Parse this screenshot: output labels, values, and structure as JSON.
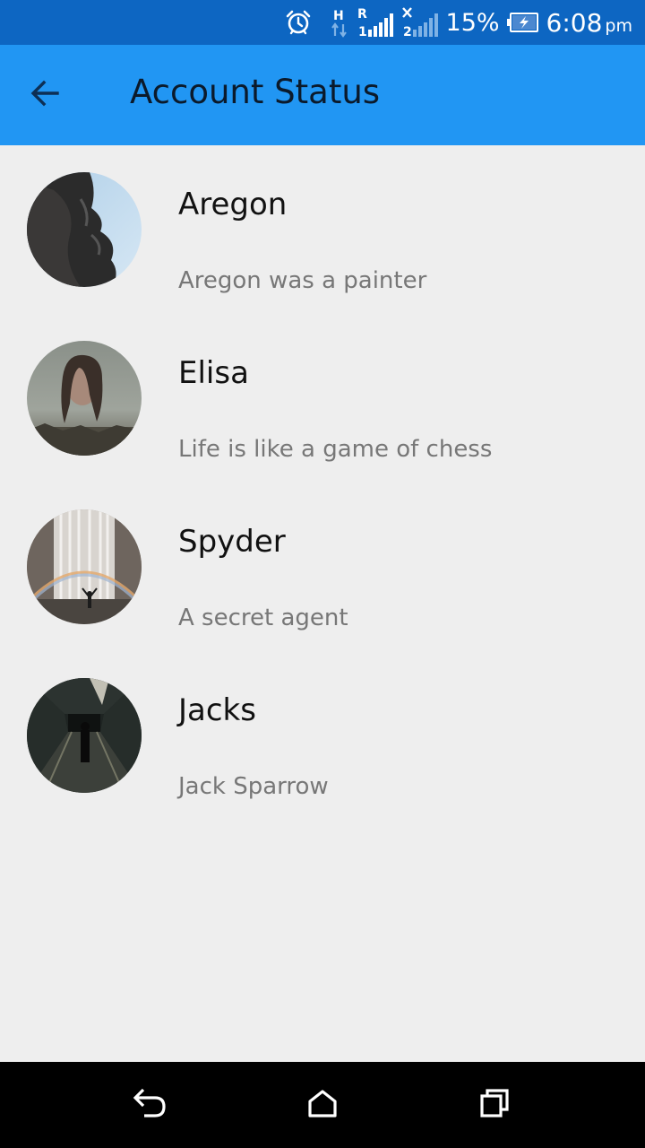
{
  "status_bar": {
    "icons": [
      "alarm-icon",
      "h-data-icon",
      "sim1-signal-icon",
      "sim2-signal-icon",
      "battery-charging-icon"
    ],
    "network_type": "H",
    "roaming": "R",
    "sim1_label": "1",
    "sim2_label": "2",
    "battery": "15%",
    "time": "6:08",
    "ampm": "pm"
  },
  "app_bar": {
    "title": "Account Status",
    "color": "#2196F3"
  },
  "contacts": [
    {
      "name": "Aregon",
      "status": "Aregon was a painter",
      "avatar": "rock-face-photo"
    },
    {
      "name": "Elisa",
      "status": "Life is like a game of chess",
      "avatar": "woman-portrait-photo"
    },
    {
      "name": "Spyder",
      "status": "A secret agent",
      "avatar": "waterfall-rainbow-photo"
    },
    {
      "name": "Jacks",
      "status": "Jack Sparrow",
      "avatar": "tunnel-walker-photo"
    }
  ],
  "nav_bar": {
    "icons": [
      "back-icon",
      "home-icon",
      "recents-icon"
    ]
  }
}
